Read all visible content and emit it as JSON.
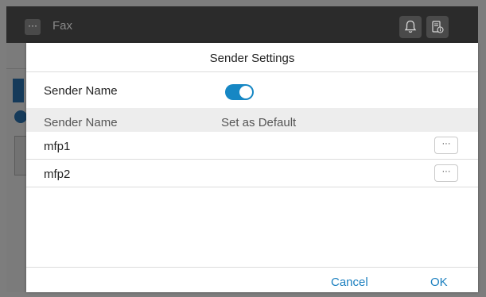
{
  "header": {
    "title": "Fax",
    "menu_icon_label": "···"
  },
  "dialog": {
    "title": "Sender Settings",
    "sender_name_label": "Sender Name",
    "sender_name_enabled": true,
    "columns": [
      "Sender Name",
      "Set as Default"
    ],
    "rows": [
      {
        "name": "mfp1",
        "more": "···"
      },
      {
        "name": "mfp2",
        "more": "···"
      }
    ],
    "cancel_label": "Cancel",
    "ok_label": "OK"
  },
  "colors": {
    "accent": "#1687c4",
    "link": "#1a7fbf",
    "topbar": "#2b2b2b"
  }
}
